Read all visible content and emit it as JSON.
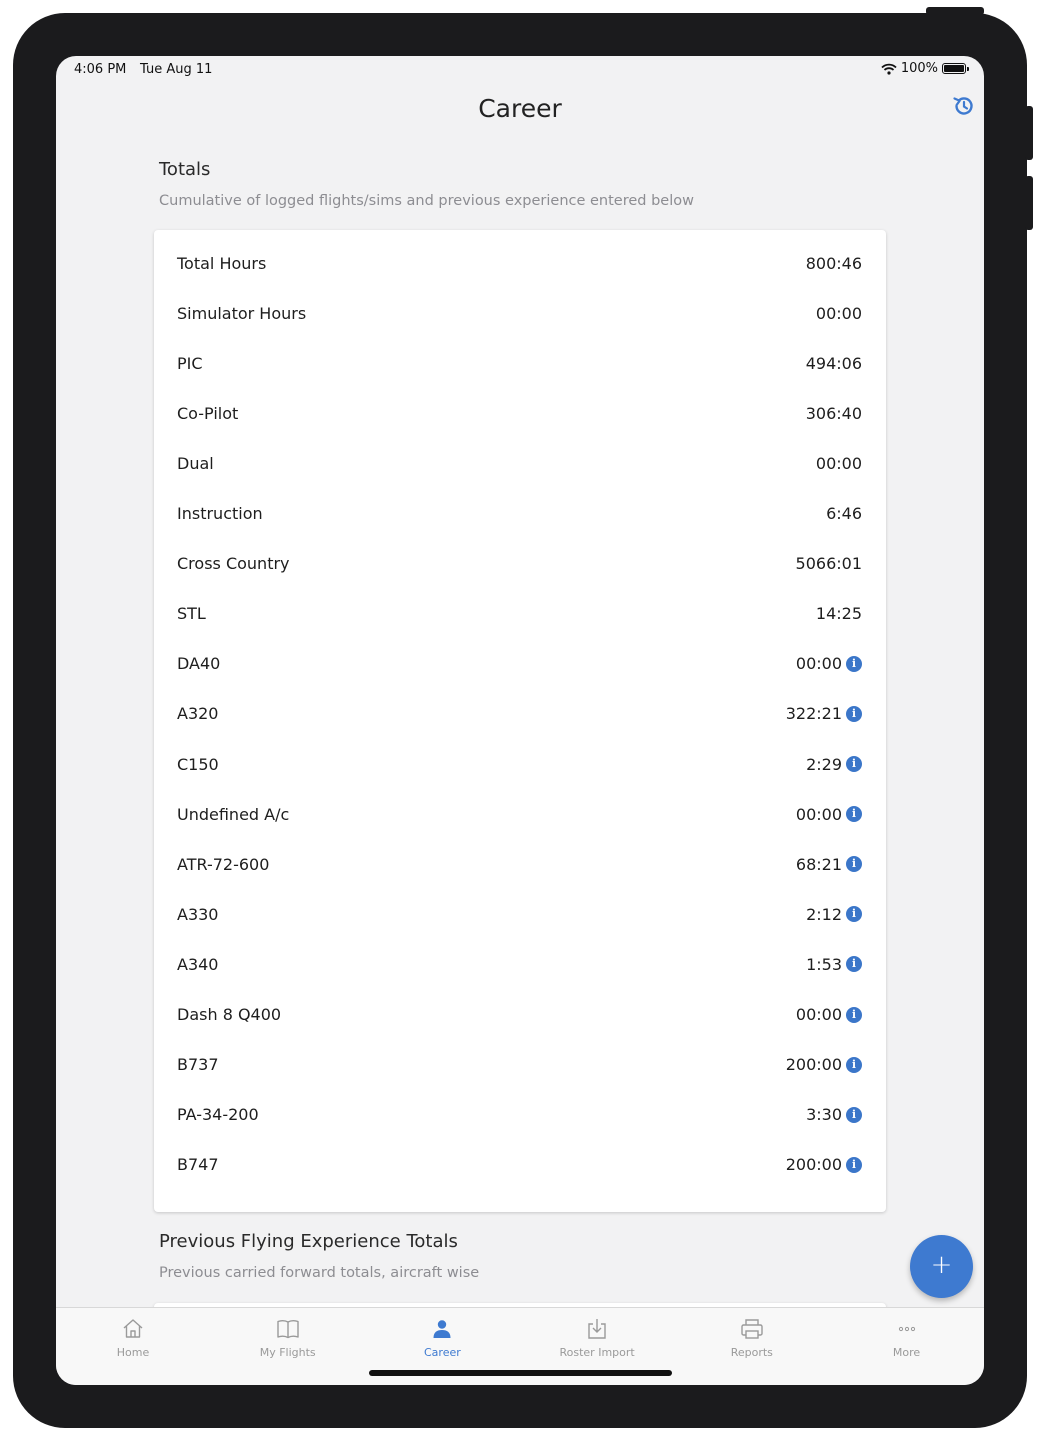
{
  "status_bar": {
    "time": "4:06 PM",
    "date": "Tue Aug 11",
    "battery": "100%"
  },
  "nav": {
    "title": "Career",
    "history_icon": "history-icon"
  },
  "totals": {
    "title": "Totals",
    "subtitle": "Cumulative of logged flights/sims and previous experience entered below",
    "rows": [
      {
        "label": "Total Hours",
        "value": "800:46",
        "info": false
      },
      {
        "label": "Simulator Hours",
        "value": "00:00",
        "info": false
      },
      {
        "label": "PIC",
        "value": "494:06",
        "info": false
      },
      {
        "label": "Co-Pilot",
        "value": "306:40",
        "info": false
      },
      {
        "label": "Dual",
        "value": "00:00",
        "info": false
      },
      {
        "label": "Instruction",
        "value": "6:46",
        "info": false
      },
      {
        "label": "Cross Country",
        "value": "5066:01",
        "info": false
      },
      {
        "label": "STL",
        "value": "14:25",
        "info": false
      },
      {
        "label": "DA40",
        "value": "00:00",
        "info": true
      },
      {
        "label": "A320",
        "value": "322:21",
        "info": true
      },
      {
        "label": "C150",
        "value": "2:29",
        "info": true
      },
      {
        "label": "Undefined A/c",
        "value": "00:00",
        "info": true
      },
      {
        "label": "ATR-72-600",
        "value": "68:21",
        "info": true
      },
      {
        "label": "A330",
        "value": "2:12",
        "info": true
      },
      {
        "label": "A340",
        "value": "1:53",
        "info": true
      },
      {
        "label": "Dash 8 Q400",
        "value": "00:00",
        "info": true
      },
      {
        "label": "B737",
        "value": "200:00",
        "info": true
      },
      {
        "label": "PA-34-200",
        "value": "3:30",
        "info": true
      },
      {
        "label": "B747",
        "value": "200:00",
        "info": true
      }
    ]
  },
  "previous": {
    "title": "Previous Flying Experience Totals",
    "subtitle": "Previous carried forward totals, aircraft wise"
  },
  "fab": {
    "symbol": "+"
  },
  "tabs": [
    {
      "label": "Home",
      "icon": "home-icon",
      "active": false
    },
    {
      "label": "My Flights",
      "icon": "book-icon",
      "active": false
    },
    {
      "label": "Career",
      "icon": "person-icon",
      "active": true
    },
    {
      "label": "Roster Import",
      "icon": "import-icon",
      "active": false
    },
    {
      "label": "Reports",
      "icon": "printer-icon",
      "active": false
    },
    {
      "label": "More",
      "icon": "more-icon",
      "active": false
    }
  ],
  "colors": {
    "accent": "#3e7ad0",
    "info": "#3b76c9",
    "background": "#f2f2f3",
    "frame": "#1b1b1d"
  }
}
